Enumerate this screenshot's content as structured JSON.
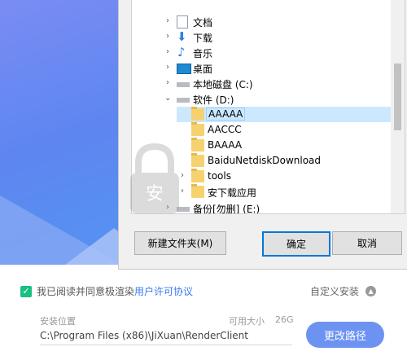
{
  "tree": {
    "items": [
      {
        "label": "文档",
        "icon": "document-icon"
      },
      {
        "label": "下载",
        "icon": "download-icon"
      },
      {
        "label": "音乐",
        "icon": "music-icon"
      },
      {
        "label": "桌面",
        "icon": "desktop-icon"
      },
      {
        "label": "本地磁盘 (C:)",
        "icon": "drive-icon"
      },
      {
        "label": "软件 (D:)",
        "icon": "drive-icon"
      },
      {
        "label": "AAAAA",
        "icon": "folder-icon"
      },
      {
        "label": "AACCC",
        "icon": "folder-icon"
      },
      {
        "label": "BAAAA",
        "icon": "folder-icon"
      },
      {
        "label": "BaiduNetdiskDownload",
        "icon": "folder-icon"
      },
      {
        "label": "tools",
        "icon": "folder-icon"
      },
      {
        "label": "安下载应用",
        "icon": "folder-icon"
      },
      {
        "label": "备份[勿删] (E:)",
        "icon": "drive-icon"
      }
    ],
    "selected": "AAAAA"
  },
  "dialog": {
    "new_folder_label": "新建文件夹(M)",
    "ok_label": "确定",
    "cancel_label": "取消"
  },
  "installer": {
    "agree_prefix": "我已阅读并同意极渲染",
    "agree_link": "用户许可协议",
    "custom_install_label": "自定义安装",
    "path_label": "安装位置",
    "available_label": "可用大小",
    "available_value": "26G",
    "install_path": "C:\\Program Files (x86)\\JiXuan\\RenderClient",
    "change_path_label": "更改路径"
  },
  "colors": {
    "accent": "#6c93f2",
    "check_green": "#19c081",
    "link_blue": "#3c7bf0",
    "selection": "#cce8ff"
  }
}
